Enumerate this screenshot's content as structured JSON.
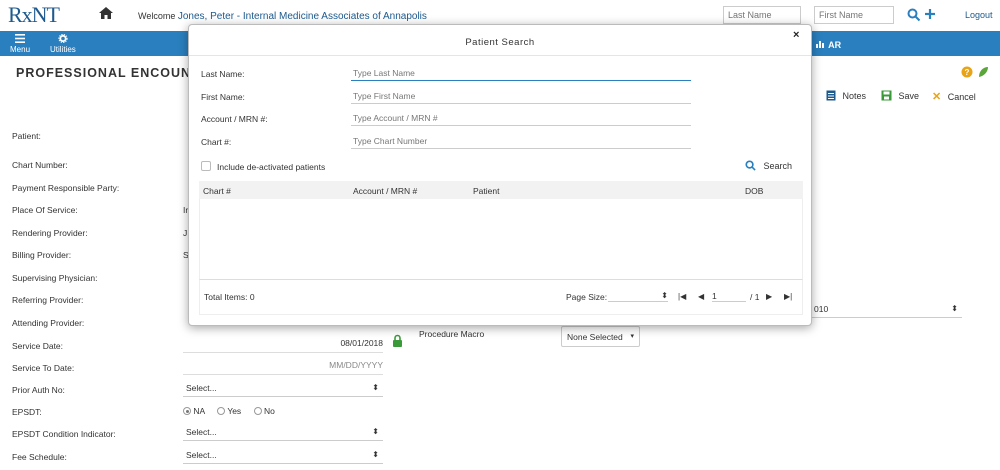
{
  "header": {
    "logo": "RxNT",
    "welcome_label": "Welcome",
    "user_name": "Jones, Peter - Internal Medicine Associates of Annapolis",
    "last_name_placeholder": "Last Name",
    "first_name_placeholder": "First Name",
    "logout": "Logout"
  },
  "nav": {
    "menu": "Menu",
    "utilities": "Utilities",
    "ar": "AR"
  },
  "page": {
    "title": "PROFESSIONAL ENCOUNTER",
    "toolbar": {
      "notes": "Notes",
      "save": "Save",
      "cancel": "Cancel"
    },
    "labels": {
      "patient": "Patient:",
      "chart_number": "Chart Number:",
      "payment_party": "Payment Responsible Party:",
      "place_of_service": "Place Of Service:",
      "rendering_provider": "Rendering Provider:",
      "billing_provider": "Billing Provider:",
      "supervising_physician": "Supervising Physician:",
      "referring_provider": "Referring Provider:",
      "attending_provider": "Attending Provider:",
      "service_date": "Service Date:",
      "service_to_date": "Service To Date:",
      "prior_auth_no": "Prior Auth No:",
      "epsdt": "EPSDT:",
      "epsdt_condition": "EPSDT Condition Indicator:",
      "fee_schedule": "Fee Schedule:"
    },
    "partial_values": {
      "place": "Ir",
      "rendering": "J",
      "billing": "S"
    },
    "service_date_value": "08/01/2018",
    "service_to_placeholder": "MM/DD/YYYY",
    "select_placeholder": "Select...",
    "epsdt_options": [
      "NA",
      "Yes",
      "No"
    ],
    "procedure_macro_label": "Procedure Macro",
    "procedure_macro_value": "None Selected",
    "partial_right_select": "010"
  },
  "modal": {
    "title": "Patient Search",
    "close": "×",
    "fields": {
      "last_name_label": "Last Name:",
      "last_name_placeholder": "Type Last Name",
      "first_name_label": "First Name:",
      "first_name_placeholder": "Type First Name",
      "account_label": "Account / MRN #:",
      "account_placeholder": "Type Account / MRN #",
      "chart_label": "Chart #:",
      "chart_placeholder": "Type Chart Number"
    },
    "include_deactivated": "Include de-activated patients",
    "search": "Search",
    "columns": [
      "Chart #",
      "Account / MRN #",
      "Patient",
      "DOB"
    ],
    "total_items": "Total Items: 0",
    "page_size_label": "Page Size:",
    "page_number": "1",
    "page_total": "/ 1"
  },
  "colors": {
    "brand": "#1d5a8e",
    "nav": "#2a7fbe",
    "green": "#3a9a3a",
    "orange": "#e8a317"
  }
}
